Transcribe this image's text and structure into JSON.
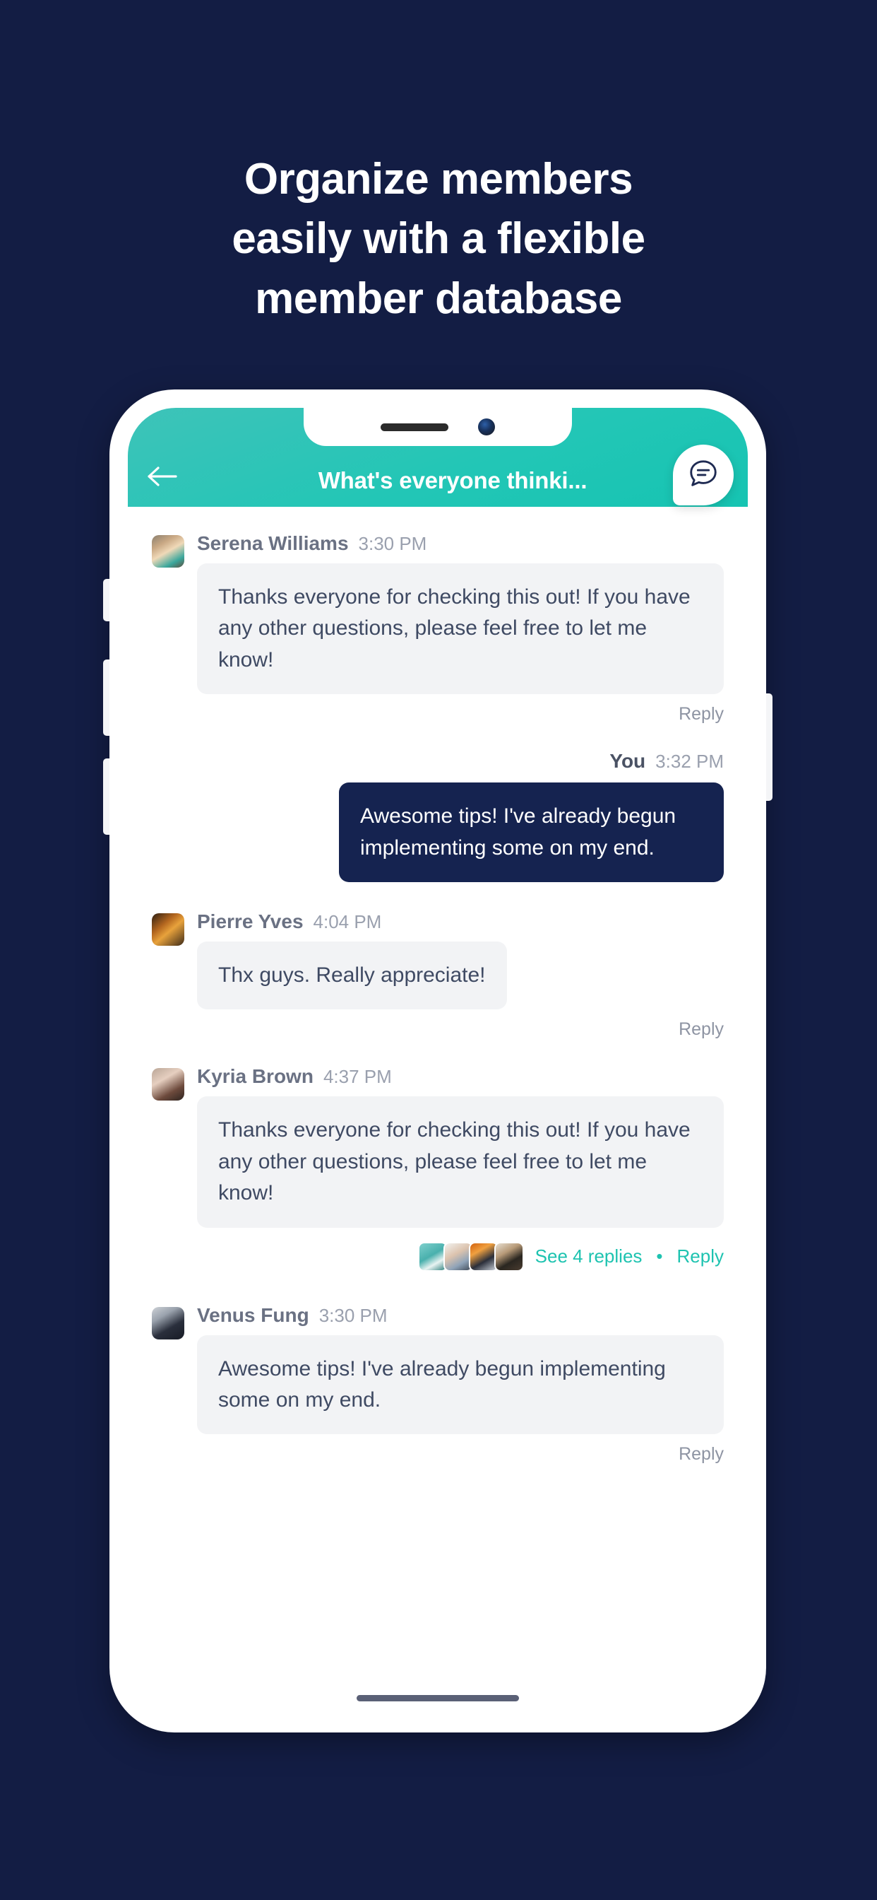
{
  "headline": {
    "line1": "Organize members",
    "line2": "easily with a flexible",
    "line3": "member database"
  },
  "colors": {
    "background": "#131d44",
    "accent_teal": "#1ec3b0",
    "header_gradient_start": "#3ec3b9",
    "header_gradient_end": "#16c4b2",
    "outgoing_bubble": "#152350",
    "incoming_bubble": "#f2f3f5"
  },
  "nav": {
    "back_icon": "arrow-left-icon",
    "title": "What's everyone thinki...",
    "action_icon": "chat-bubble-icon"
  },
  "chat": {
    "messages": [
      {
        "id": "m1",
        "direction": "incoming",
        "name": "Serena Williams",
        "time": "3:30 PM",
        "text": "Thanks everyone for checking this out! If you have any other questions, please feel free to let me know!",
        "reply_label": "Reply",
        "avatar_class": "av-serena"
      },
      {
        "id": "m2",
        "direction": "outgoing",
        "name": "You",
        "time": "3:32 PM",
        "text": "Awesome tips! I've already begun implementing some on my end."
      },
      {
        "id": "m3",
        "direction": "incoming",
        "name": "Pierre Yves",
        "time": "4:04 PM",
        "text": "Thx guys. Really appreciate!",
        "reply_label": "Reply",
        "avatar_class": "av-pierre"
      },
      {
        "id": "m4",
        "direction": "incoming",
        "name": "Kyria Brown",
        "time": "4:37 PM",
        "text": "Thanks everyone for checking this out! If you have any other questions, please feel free to let me know!",
        "avatar_class": "av-kyria",
        "thread": {
          "see_replies_label": "See 4 replies",
          "separator": "•",
          "reply_label": "Reply",
          "reply_count": 4,
          "participant_avatars": [
            "av-r1",
            "av-r2",
            "av-r3",
            "av-r4"
          ]
        }
      },
      {
        "id": "m5",
        "direction": "incoming",
        "name": "Venus Fung",
        "time": "3:30 PM",
        "text": "Awesome tips! I've already begun implementing some on my end.",
        "reply_label": "Reply",
        "avatar_class": "av-venus"
      }
    ]
  },
  "device": {
    "notch_speaker": "speaker-grille",
    "notch_camera": "front-camera",
    "home_indicator": "home-indicator"
  }
}
